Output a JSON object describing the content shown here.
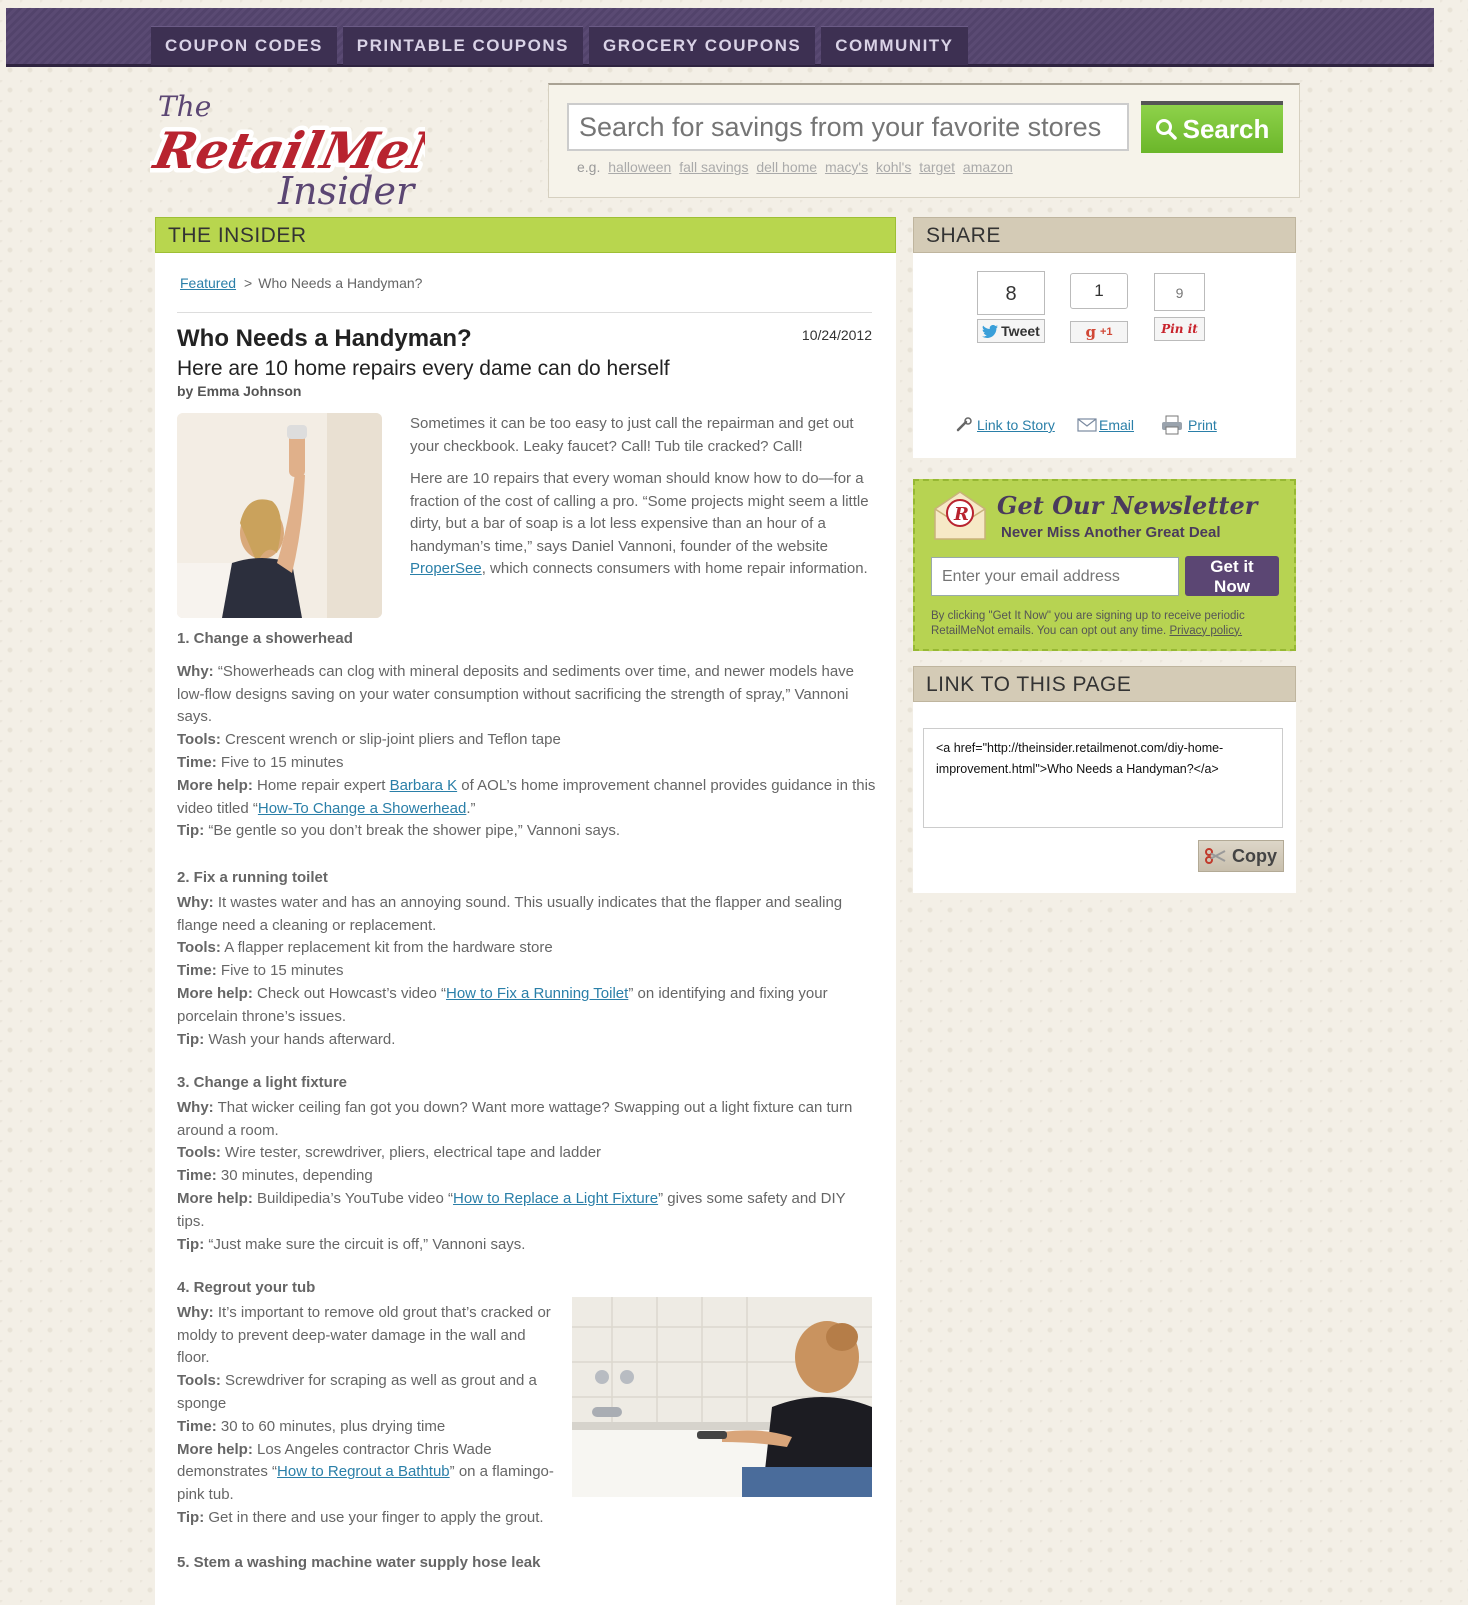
{
  "nav": {
    "tabs": [
      "COUPON CODES",
      "PRINTABLE COUPONS",
      "GROCERY COUPONS",
      "COMMUNITY"
    ]
  },
  "logo": {
    "text_top": "The",
    "text_main": "RetailMeNot",
    "text_bottom": "Insider"
  },
  "search": {
    "placeholder": "Search for savings from your favorite stores",
    "button": "Search",
    "eg_label": "e.g.",
    "examples": [
      "halloween",
      "fall savings",
      "dell home",
      "macy's",
      "kohl's",
      "target",
      "amazon"
    ]
  },
  "main": {
    "header": "THE INSIDER",
    "breadcrumb": {
      "link": "Featured",
      "sep": ">",
      "current": "Who Needs a Handyman?"
    },
    "title": "Who Needs a Handyman?",
    "date": "10/24/2012",
    "subtitle": "Here are 10 home repairs every dame can do herself",
    "byline": "by Emma Johnson",
    "intro": {
      "p1": "Sometimes it can be too easy to just call the repairman and get out your checkbook. Leaky faucet? Call! Tub tile cracked? Call!",
      "p2_a": "Here are 10 repairs that every woman should know how to do—for a fraction of the cost of calling a pro. “Some projects might seem a little dirty, but a bar of soap is a lot less expensive than an hour of a handyman’s time,” says Daniel Vannoni, founder of the website ",
      "p2_link": "ProperSee",
      "p2_b": ", which connects consumers with home repair information."
    },
    "labels": {
      "why": "Why:",
      "tools": "Tools:",
      "time": "Time:",
      "more": "More help:",
      "tip": "Tip:"
    },
    "s1": {
      "heading": "1. Change a showerhead",
      "why": " “Showerheads can clog with mineral deposits and sediments over time, and newer models have low-flow designs saving on your water consumption without sacrificing the strength of spray,” Vannoni says.",
      "tools": " Crescent wrench or slip-joint pliers and Teflon tape",
      "time": " Five to 15 minutes",
      "more_a": " Home repair expert ",
      "more_link1": "Barbara K",
      "more_b": " of AOL’s home improvement channel provides guidance in this video titled “",
      "more_link2": "How-To Change a Showerhead",
      "more_c": ".”",
      "tip": " “Be gentle so you don’t break the shower pipe,” Vannoni says."
    },
    "s2": {
      "heading": "2. Fix a running toilet",
      "why": " It wastes water and has an annoying sound. This usually indicates that the flapper and sealing flange need a cleaning or replacement.",
      "tools": " A flapper replacement kit from the hardware store",
      "time": " Five to 15 minutes",
      "more_a": " Check out Howcast’s video “",
      "more_link": "How to Fix a Running Toilet",
      "more_b": "” on identifying and fixing your porcelain throne’s issues.",
      "tip": " Wash your hands afterward."
    },
    "s3": {
      "heading": "3. Change a light fixture",
      "why": " That wicker ceiling fan got you down? Want more wattage? Swapping out a light fixture can turn around a room.",
      "tools": " Wire tester, screwdriver, pliers, electrical tape and ladder",
      "time": " 30 minutes, depending",
      "more_a": " Buildipedia’s YouTube video “",
      "more_link": "How to Replace a Light Fixture",
      "more_b": "” gives some safety and DIY tips.",
      "tip": " “Just make sure the circuit is off,” Vannoni says."
    },
    "s4": {
      "heading": "4. Regrout your tub",
      "why": " It’s important to remove old grout that’s cracked or moldy to prevent deep-water damage in the wall and floor.",
      "tools": " Screwdriver for scraping as well as grout and a sponge",
      "time": " 30 to 60 minutes, plus drying time",
      "more_a": " Los Angeles contractor Chris Wade demonstrates “",
      "more_link": "How to Regrout a Bathtub",
      "more_b": "” on a flamingo-pink tub.",
      "tip": " Get in there and use your finger to apply the grout."
    },
    "s5": {
      "heading": "5. Stem a washing machine water supply hose leak"
    }
  },
  "share": {
    "header": "SHARE",
    "tweet_count": "8",
    "tweet_label": "Tweet",
    "plus_count": "1",
    "plus_label": "+1",
    "pin_count": "9",
    "pin_label": "Pin it",
    "link_story": "Link to Story",
    "email": "Email",
    "print": "Print"
  },
  "newsletter": {
    "title": "Get Our Newsletter",
    "subtitle": "Never Miss Another Great Deal",
    "placeholder": "Enter your email address",
    "button": "Get it Now",
    "fine_a": "By clicking \"Get It Now\" you are signing up to receive periodic RetailMeNot emails. You can opt out any time. ",
    "fine_link": "Privacy policy."
  },
  "link_page": {
    "header": "LINK TO THIS PAGE",
    "code": "<a href=\"http://theinsider.retailmenot.com/diy-home-improvement.html\">Who Needs a Handyman?</a>",
    "copy": "Copy"
  },
  "colors": {
    "nav_purple": "#55456d",
    "accent_green": "#b8d64e",
    "link_blue": "#2a7fa8",
    "logo_red": "#b8232f"
  }
}
